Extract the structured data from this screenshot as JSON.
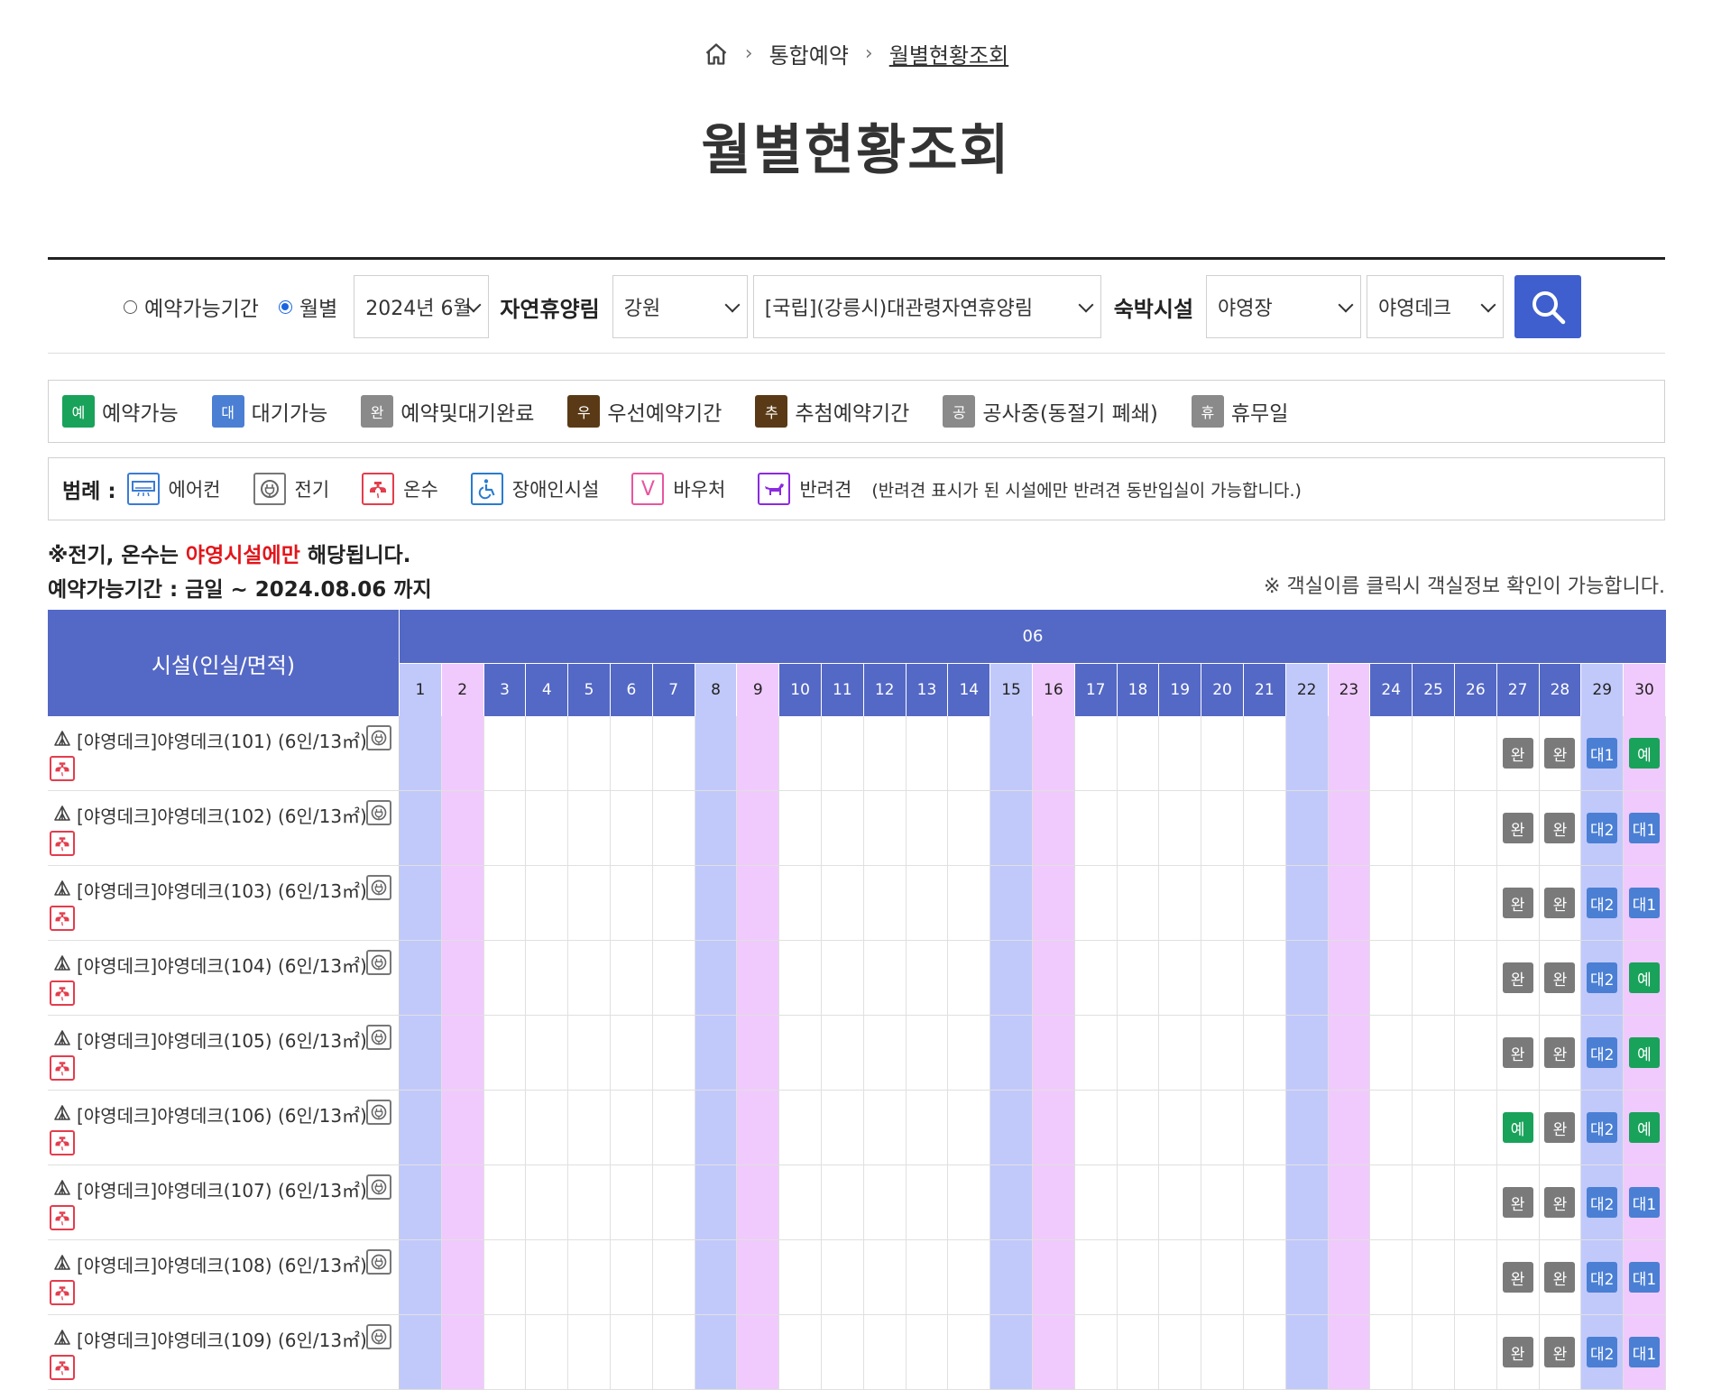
{
  "breadcrumb": {
    "home_icon": "home-icon",
    "item1": "통합예약",
    "current": "월별현황조회"
  },
  "page_title": "월별현황조회",
  "search": {
    "radio_period_label": "예약가능기간",
    "radio_month_label": "월별",
    "selected_radio": "월별",
    "month_value": "2024년 6월",
    "forest_label": "자연휴양림",
    "region_value": "강원",
    "forest_value": "[국립](강릉시)대관령자연휴양림",
    "facility_label": "숙박시설",
    "facility_type_value": "야영장",
    "facility_sub_value": "야영데크",
    "search_icon": "search-icon",
    "accent_color": "#3f5fcf"
  },
  "status_legend": [
    {
      "badge": "예",
      "label": "예약가능",
      "color": "#19a25a"
    },
    {
      "badge": "대",
      "label": "대기가능",
      "color": "#4a7fd4"
    },
    {
      "badge": "완",
      "label": "예약및대기완료",
      "color": "#8a8a8a"
    },
    {
      "badge": "우",
      "label": "우선예약기간",
      "color": "#5a3a16"
    },
    {
      "badge": "추",
      "label": "추첨예약기간",
      "color": "#5a3a16"
    },
    {
      "badge": "공",
      "label": "공사중(동절기 폐쇄)",
      "color": "#8a8a8a"
    },
    {
      "badge": "휴",
      "label": "휴무일",
      "color": "#8a8a8a"
    }
  ],
  "amenity_legend": {
    "title": "범례 :",
    "items": [
      {
        "icon": "air-conditioner-icon",
        "label": "에어컨"
      },
      {
        "icon": "electricity-icon",
        "label": "전기"
      },
      {
        "icon": "hot-water-icon",
        "label": "온수"
      },
      {
        "icon": "accessibility-icon",
        "label": "장애인시설"
      },
      {
        "icon": "voucher-icon",
        "label": "바우처"
      },
      {
        "icon": "pet-icon",
        "label": "반려견"
      }
    ],
    "note": "(반려견 표시가 된 시설에만 반려견 동반입실이 가능합니다.)"
  },
  "notes": {
    "line1_prefix": "※전기, 온수는 ",
    "line1_highlight": "야영시설에만",
    "line1_suffix": " 해당됩니다.",
    "line2": "예약가능기간 : 금일 ~ 2024.08.06 까지",
    "right": "※ 객실이름 클릭시 객실정보 확인이 가능합니다."
  },
  "grid": {
    "facility_header": "시설(인실/면적)",
    "month": "06",
    "days": [
      "1",
      "2",
      "3",
      "4",
      "5",
      "6",
      "7",
      "8",
      "9",
      "10",
      "11",
      "12",
      "13",
      "14",
      "15",
      "16",
      "17",
      "18",
      "19",
      "20",
      "21",
      "22",
      "23",
      "24",
      "25",
      "26",
      "27",
      "28",
      "29",
      "30"
    ],
    "saturday_days": [
      1,
      8,
      15,
      22,
      29
    ],
    "sunday_days": [
      2,
      9,
      16,
      23,
      30
    ],
    "rows": [
      {
        "name": "[야영데크]야영데크(101) (6인/13㎡)",
        "day27": "완",
        "day28": "완",
        "day29": "대1",
        "day30": "예"
      },
      {
        "name": "[야영데크]야영데크(102) (6인/13㎡)",
        "day27": "완",
        "day28": "완",
        "day29": "대2",
        "day30": "대1"
      },
      {
        "name": "[야영데크]야영데크(103) (6인/13㎡)",
        "day27": "완",
        "day28": "완",
        "day29": "대2",
        "day30": "대1"
      },
      {
        "name": "[야영데크]야영데크(104) (6인/13㎡)",
        "day27": "완",
        "day28": "완",
        "day29": "대2",
        "day30": "예"
      },
      {
        "name": "[야영데크]야영데크(105) (6인/13㎡)",
        "day27": "완",
        "day28": "완",
        "day29": "대2",
        "day30": "예"
      },
      {
        "name": "[야영데크]야영데크(106) (6인/13㎡)",
        "day27": "예",
        "day28": "완",
        "day29": "대2",
        "day30": "예"
      },
      {
        "name": "[야영데크]야영데크(107) (6인/13㎡)",
        "day27": "완",
        "day28": "완",
        "day29": "대2",
        "day30": "대1"
      },
      {
        "name": "[야영데크]야영데크(108) (6인/13㎡)",
        "day27": "완",
        "day28": "완",
        "day29": "대2",
        "day30": "대1"
      },
      {
        "name": "[야영데크]야영데크(109) (6인/13㎡)",
        "day27": "완",
        "day28": "완",
        "day29": "대2",
        "day30": "대1"
      }
    ]
  }
}
